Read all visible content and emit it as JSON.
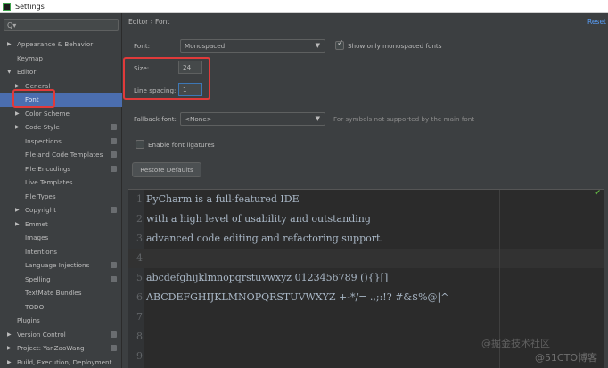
{
  "window": {
    "title": "Settings"
  },
  "search": {
    "placeholder": "Q▾"
  },
  "sidebar": {
    "items": [
      {
        "label": "Appearance & Behavior",
        "arrow": "▶",
        "indent": 0
      },
      {
        "label": "Keymap",
        "arrow": "",
        "indent": 0
      },
      {
        "label": "Editor",
        "arrow": "▼",
        "indent": 0
      },
      {
        "label": "General",
        "arrow": "▶",
        "indent": 1
      },
      {
        "label": "Font",
        "arrow": "",
        "indent": 1,
        "selected": true
      },
      {
        "label": "Color Scheme",
        "arrow": "▶",
        "indent": 1
      },
      {
        "label": "Code Style",
        "arrow": "▶",
        "indent": 1,
        "proj": true
      },
      {
        "label": "Inspections",
        "arrow": "",
        "indent": 1,
        "proj": true
      },
      {
        "label": "File and Code Templates",
        "arrow": "",
        "indent": 1,
        "proj": true
      },
      {
        "label": "File Encodings",
        "arrow": "",
        "indent": 1,
        "proj": true
      },
      {
        "label": "Live Templates",
        "arrow": "",
        "indent": 1
      },
      {
        "label": "File Types",
        "arrow": "",
        "indent": 1
      },
      {
        "label": "Copyright",
        "arrow": "▶",
        "indent": 1,
        "proj": true
      },
      {
        "label": "Emmet",
        "arrow": "▶",
        "indent": 1
      },
      {
        "label": "Images",
        "arrow": "",
        "indent": 1
      },
      {
        "label": "Intentions",
        "arrow": "",
        "indent": 1
      },
      {
        "label": "Language Injections",
        "arrow": "",
        "indent": 1,
        "proj": true
      },
      {
        "label": "Spelling",
        "arrow": "",
        "indent": 1,
        "proj": true
      },
      {
        "label": "TextMate Bundles",
        "arrow": "",
        "indent": 1
      },
      {
        "label": "TODO",
        "arrow": "",
        "indent": 1
      },
      {
        "label": "Plugins",
        "arrow": "",
        "indent": 0
      },
      {
        "label": "Version Control",
        "arrow": "▶",
        "indent": 0,
        "proj": true
      },
      {
        "label": "Project: YanZaoWang",
        "arrow": "▶",
        "indent": 0,
        "proj": true
      },
      {
        "label": "Build, Execution, Deployment",
        "arrow": "▶",
        "indent": 0
      }
    ]
  },
  "header": {
    "breadcrumb": "Editor  ›  Font",
    "reset": "Reset"
  },
  "font": {
    "font_label": "Font:",
    "font_value": "Monospaced",
    "only_mono_label": "Show only monospaced fonts",
    "only_mono_checked": true,
    "size_label": "Size:",
    "size_value": "24",
    "spacing_label": "Line spacing:",
    "spacing_value": "1",
    "fallback_label": "Fallback font:",
    "fallback_value": "<None>",
    "fallback_hint": "For symbols not supported by the main font",
    "ligatures_label": "Enable font ligatures",
    "ligatures_checked": false,
    "restore_label": "Restore Defaults"
  },
  "preview": {
    "lines": [
      {
        "num": "1",
        "text": "PyCharm is a full-featured IDE"
      },
      {
        "num": "2",
        "text": "with a high level of usability and outstanding"
      },
      {
        "num": "3",
        "text": "advanced code editing and refactoring support."
      },
      {
        "num": "4",
        "text": ""
      },
      {
        "num": "5",
        "text": "abcdefghijklmnopqrstuvwxyz 0123456789 (){}[]"
      },
      {
        "num": "6",
        "text": "ABCDEFGHIJKLMNOPQRSTUVWXYZ +-*/= .,;:!? #&$%@|^"
      },
      {
        "num": "7",
        "text": ""
      },
      {
        "num": "8",
        "text": ""
      },
      {
        "num": "9",
        "text": ""
      }
    ]
  },
  "watermarks": {
    "a": "@掘金技术社区",
    "b": "@51CTO博客"
  },
  "colors": {
    "highlight": "#e03a3a",
    "selection": "#4b6eaf",
    "link": "#589df6"
  }
}
